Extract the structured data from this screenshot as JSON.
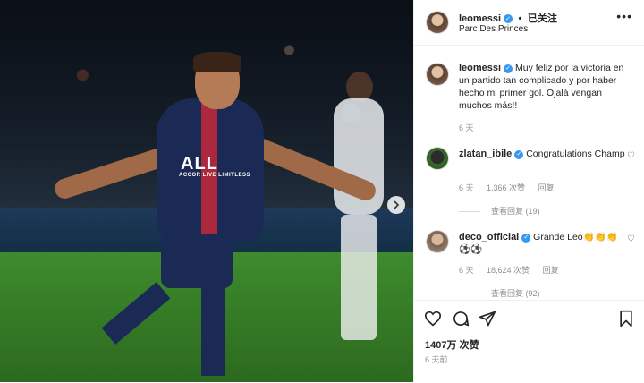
{
  "post": {
    "photo": {
      "sponsor_text": "ALL",
      "sponsor_subtext": "ACCOR LIVE LIMITLESS",
      "next_icon": "chevron-right-icon"
    },
    "header": {
      "username": "leomessi",
      "verified_icon": "verified-badge-icon",
      "separator": "•",
      "follow_status": "已关注",
      "location": "Parc Des Princes",
      "more_icon": "more-options-icon",
      "more_glyph": "•••"
    },
    "caption": {
      "username": "leomessi",
      "text": "Muy feliz por la victoria en un partido tan complicado y por haber hecho mi primer gol. Ojalá vengan muchos más!!",
      "time": "6 天"
    },
    "comments": [
      {
        "username": "zlatan_ibile",
        "text": "Congratulations Champ",
        "time": "6 天",
        "likes": "1,366 次赞",
        "reply": "回复",
        "view_replies": "查看回复 (19)"
      },
      {
        "username": "deco_official",
        "text": "Grande Leo👏👏👏⚽⚽",
        "time": "6 天",
        "likes": "18,624 次赞",
        "reply": "回复",
        "view_replies": "查看回复 (92)"
      }
    ],
    "actions": {
      "like_icon": "heart-icon",
      "comment_icon": "comment-icon",
      "share_icon": "send-icon",
      "save_icon": "bookmark-icon",
      "likes": "1407万 次赞",
      "posted": "6 天前"
    },
    "colors": {
      "verified": "#3897f0",
      "text": "#262626",
      "muted": "#8e8e8e",
      "border": "#efefef"
    }
  }
}
